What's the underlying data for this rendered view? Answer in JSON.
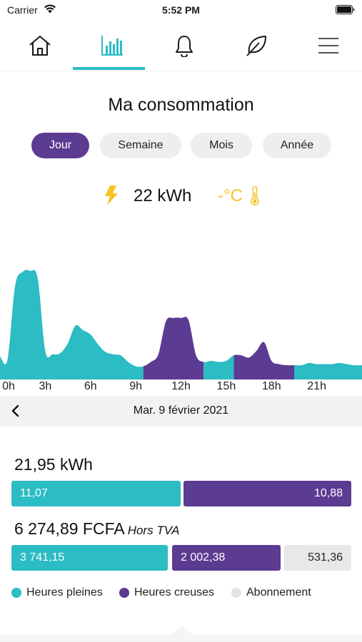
{
  "status_bar": {
    "carrier": "Carrier",
    "time": "5:52 PM"
  },
  "nav": {
    "items": [
      {
        "icon": "home-icon",
        "active": false
      },
      {
        "icon": "chart-bars-icon",
        "active": true
      },
      {
        "icon": "bell-icon",
        "active": false
      },
      {
        "icon": "leaf-icon",
        "active": false
      },
      {
        "icon": "menu-icon",
        "active": false
      }
    ]
  },
  "page": {
    "title": "Ma consommation"
  },
  "periods": [
    {
      "label": "Jour",
      "selected": true
    },
    {
      "label": "Semaine",
      "selected": false
    },
    {
      "label": "Mois",
      "selected": false
    },
    {
      "label": "Année",
      "selected": false
    }
  ],
  "summary": {
    "energy": "22 kWh",
    "temperature": "-°C"
  },
  "colors": {
    "teal": "#2cbcc4",
    "purple": "#5c3b92",
    "grey": "#e8e8e8",
    "temperature": "#f6c326"
  },
  "chart_data": {
    "type": "area",
    "xlabel": "",
    "ylabel": "",
    "x_tick_labels": [
      "0h",
      "3h",
      "6h",
      "9h",
      "12h",
      "15h",
      "18h",
      "21h"
    ],
    "x": [
      0,
      0.5,
      1,
      1.5,
      2,
      2.5,
      3,
      3.5,
      4,
      4.5,
      5,
      5.5,
      6,
      6.5,
      7,
      7.5,
      8,
      8.5,
      9,
      9.5,
      10,
      10.5,
      11,
      11.5,
      12,
      12.5,
      13,
      13.5,
      14,
      14.5,
      15,
      15.5,
      16,
      16.5,
      17,
      17.5,
      18,
      18.5,
      19,
      19.5,
      20,
      20.5,
      21,
      21.5,
      22,
      22.5,
      23,
      23.5,
      24
    ],
    "values": [
      0.21,
      0.18,
      0.85,
      0.98,
      0.99,
      0.92,
      0.26,
      0.23,
      0.24,
      0.33,
      0.49,
      0.45,
      0.41,
      0.32,
      0.25,
      0.23,
      0.22,
      0.16,
      0.12,
      0.12,
      0.16,
      0.23,
      0.53,
      0.56,
      0.56,
      0.54,
      0.22,
      0.16,
      0.17,
      0.16,
      0.17,
      0.22,
      0.22,
      0.2,
      0.26,
      0.34,
      0.17,
      0.14,
      0.13,
      0.13,
      0.13,
      0.15,
      0.14,
      0.14,
      0.14,
      0.15,
      0.14,
      0.13,
      0.13
    ],
    "segments": [
      {
        "from": 0,
        "to": 9.5,
        "tariff": "Heures pleines"
      },
      {
        "from": 9.5,
        "to": 13.5,
        "tariff": "Heures creuses"
      },
      {
        "from": 13.5,
        "to": 15.5,
        "tariff": "Heures pleines"
      },
      {
        "from": 15.5,
        "to": 19.5,
        "tariff": "Heures creuses"
      },
      {
        "from": 19.5,
        "to": 24,
        "tariff": "Heures pleines"
      }
    ],
    "grid": false
  },
  "date_nav": {
    "date": "Mar. 9 février 2021"
  },
  "breakdown": {
    "total_energy": "21,95 kWh",
    "energy_peak": "11,07",
    "energy_offpeak": "10,88",
    "energy_peak_value": 11.07,
    "energy_offpeak_value": 10.88,
    "total_cost": "6 274,89 FCFA",
    "cost_note": "Hors TVA",
    "cost_peak": "3 741,15",
    "cost_offpeak": "2 002,38",
    "cost_subscription": "531,36",
    "cost_peak_value": 3741.15,
    "cost_offpeak_value": 2002.38,
    "cost_subscription_value": 531.36
  },
  "legend": {
    "peak": "Heures pleines",
    "offpeak": "Heures creuses",
    "subscription": "Abonnement"
  }
}
